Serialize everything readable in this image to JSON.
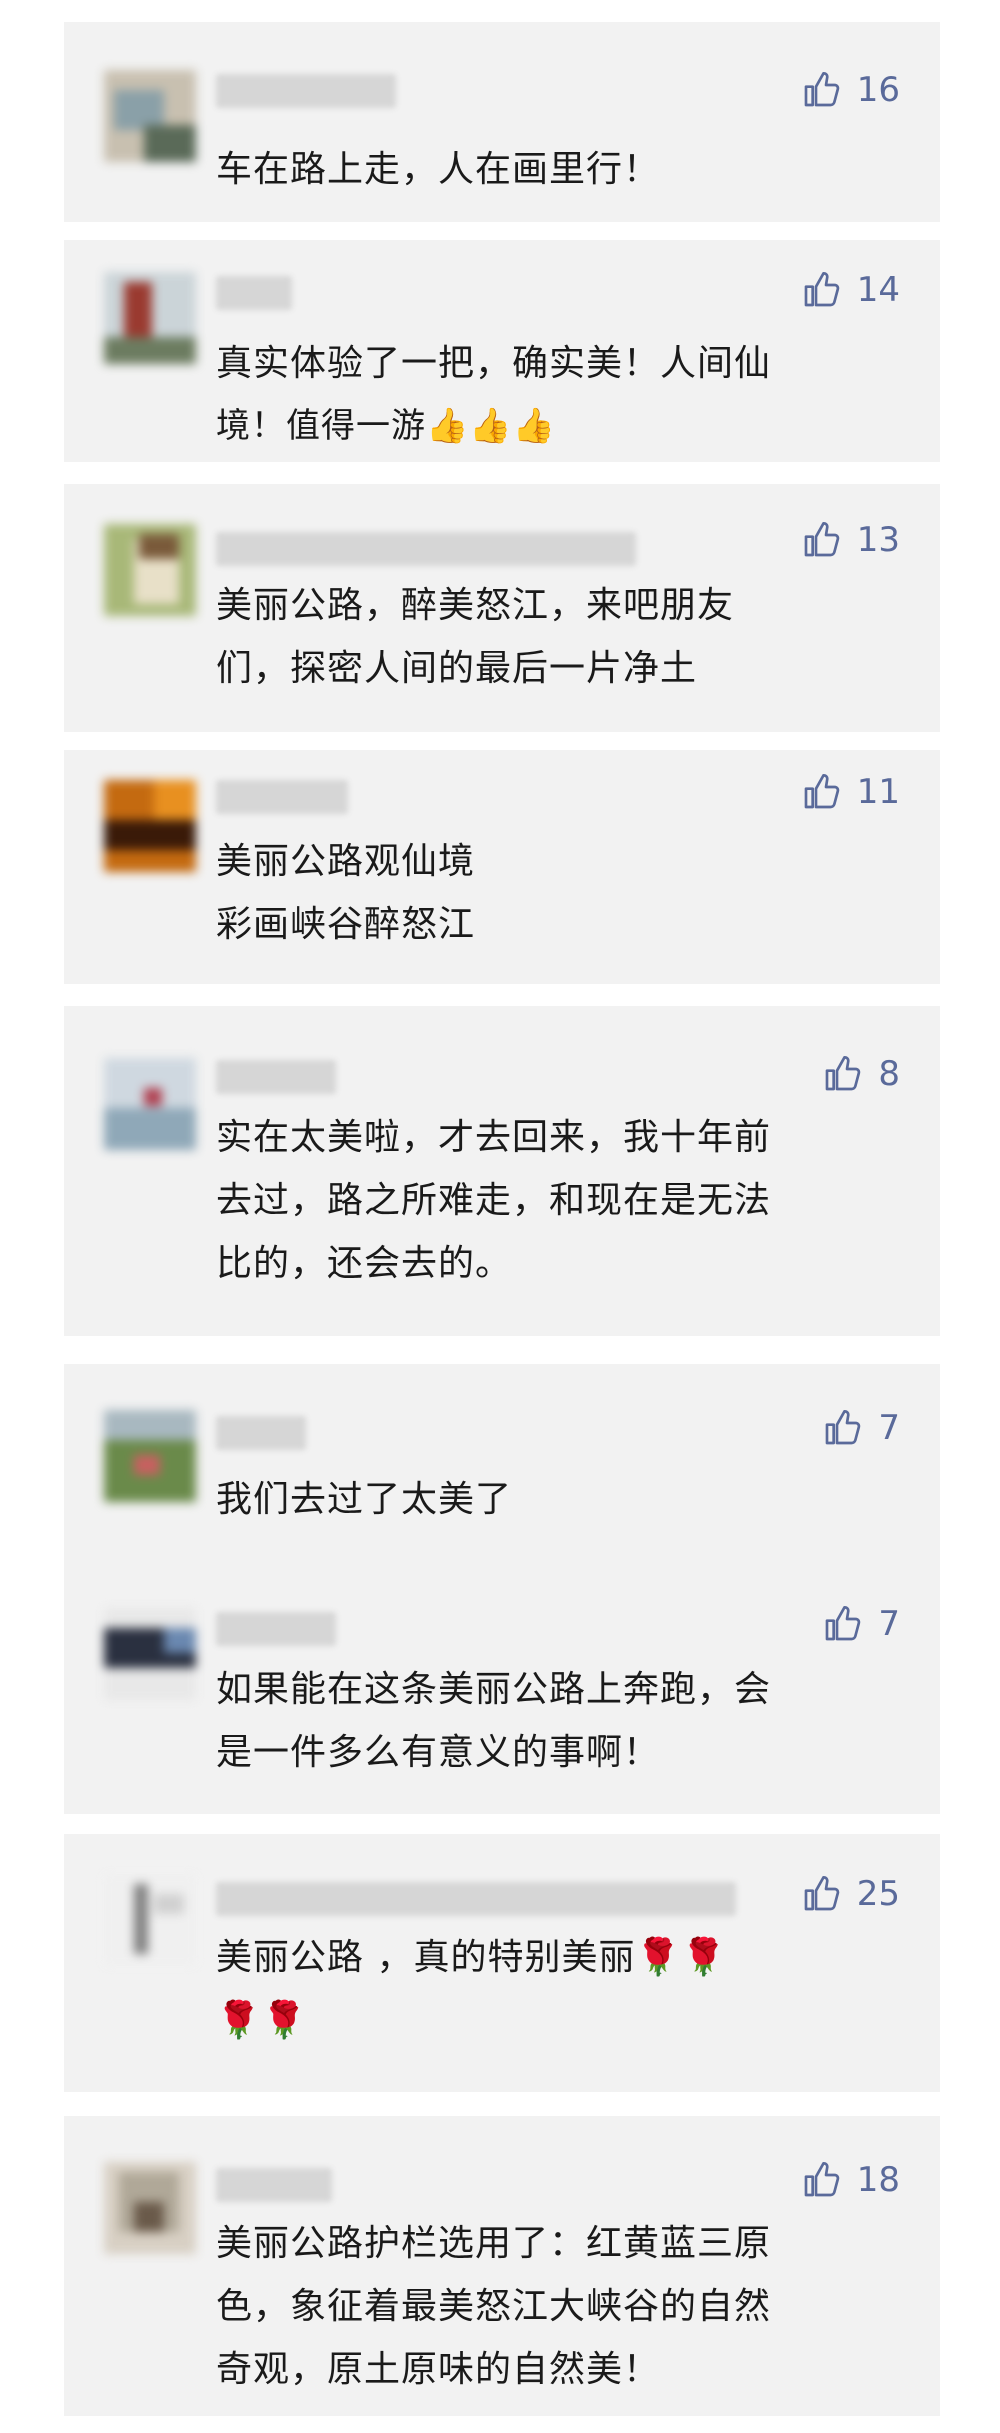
{
  "comments": [
    {
      "likes": "16",
      "lines": [
        "车在路上走，人在画里行！"
      ],
      "avatar": [
        "#c8c0b0",
        "#8aa0a8",
        "#5a6a58"
      ]
    },
    {
      "likes": "14",
      "lines": [
        "真实体验了一把，确实美！人间仙",
        "境！值得一游👍👍👍"
      ],
      "avatar": [
        "#cbd4d8",
        "#9a3a30",
        "#6c7c60"
      ]
    },
    {
      "likes": "13",
      "lines": [
        "美丽公路，醉美怒江，来吧朋友",
        "们，探密人间的最后一片净土"
      ],
      "avatar": [
        "#a8b878",
        "#e8e0c8",
        "#7a5a3a"
      ]
    },
    {
      "likes": "11",
      "lines": [
        "美丽公路观仙境",
        "彩画峡谷醉怒江"
      ],
      "avatar": [
        "#c46a10",
        "#3a1a08",
        "#e89020"
      ]
    },
    {
      "likes": "8",
      "lines": [
        "实在太美啦，才去回来，我十年前",
        "去过，路之所难走，和现在是无法",
        "比的，还会去的。"
      ],
      "avatar": [
        "#cfd8e0",
        "#8fa8b8",
        "#b04050"
      ]
    },
    {
      "likes": "7",
      "lines": [
        "我们去过了太美了"
      ],
      "avatar": [
        "#6a8a4a",
        "#c86060",
        "#a8b8c0"
      ]
    },
    {
      "likes": "7",
      "lines": [
        "如果能在这条美丽公路上奔跑，会",
        "是一件多么有意义的事啊！"
      ],
      "avatar": [
        "#e8e8e8",
        "#2a3040",
        "#6a88b0"
      ]
    },
    {
      "likes": "25",
      "lines": [
        "美丽公路 ，真的特别美丽🌹🌹",
        "🌹🌹"
      ],
      "avatar": [
        "#f0f0f0",
        "#808080",
        "#d0d0d0"
      ]
    },
    {
      "likes": "18",
      "lines": [
        "美丽公路护栏选用了：红黄蓝三原",
        "色，象征着最美怒江大峡谷的自然",
        "奇观，原土原味的自然美！"
      ],
      "avatar": [
        "#b0a898",
        "#6a5a4a",
        "#d8d0c4"
      ]
    }
  ],
  "colors": {
    "background": "#ffffff",
    "card": "#f2f2f2",
    "text": "#1a1a1a",
    "like": "#5a6a9a"
  }
}
